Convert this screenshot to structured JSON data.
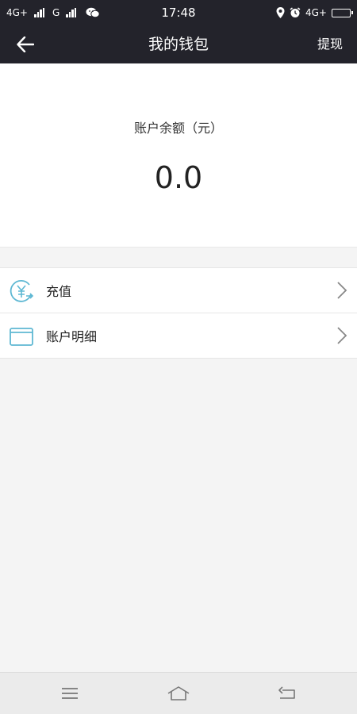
{
  "status_bar": {
    "network_1": "4G+",
    "network_2": "G",
    "time": "17:48",
    "network_right": "4G+"
  },
  "header": {
    "title": "我的钱包",
    "withdraw_label": "提现"
  },
  "balance": {
    "label": "账户余额（元）",
    "value": "0.0"
  },
  "menu": {
    "items": [
      {
        "label": "充值",
        "icon": "yuan-recharge-icon"
      },
      {
        "label": "账户明细",
        "icon": "card-icon"
      }
    ]
  },
  "colors": {
    "header_bg": "#23232b",
    "icon_accent": "#5fb8d3",
    "page_bg": "#f4f4f4"
  }
}
